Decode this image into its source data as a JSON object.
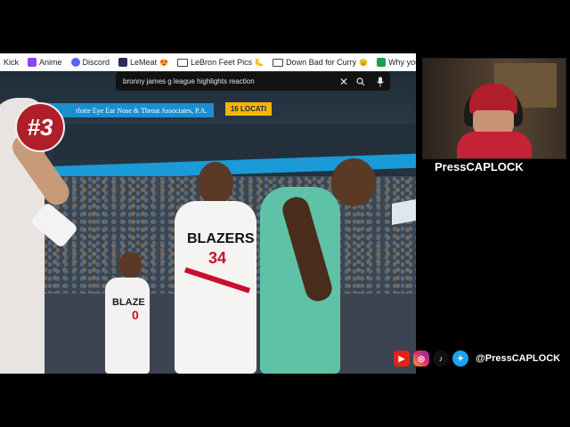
{
  "bookmarks": [
    {
      "label": "Kick",
      "icon": "kick-icon",
      "emoji": ""
    },
    {
      "label": "Anime",
      "icon": "twitch-icon",
      "emoji": ""
    },
    {
      "label": "Discord",
      "icon": "discord-icon",
      "emoji": ""
    },
    {
      "label": "LeMeat",
      "icon": "lemeat-icon",
      "emoji": "😍"
    },
    {
      "label": "LeBron Feet Pics",
      "icon": "folder-icon",
      "emoji": "🦶"
    },
    {
      "label": "Down Bad for Curry",
      "icon": "folder-icon",
      "emoji": "😉"
    },
    {
      "label": "Why you LOOKIN",
      "icon": "plus-icon",
      "emoji": ""
    }
  ],
  "search": {
    "query": "bronny james g league highlights reaction"
  },
  "overlay": {
    "rank": "#3",
    "channel_name": "PressCAPLOCK",
    "social_handle": "@PressCAPLOCK"
  },
  "arena": {
    "banner_text": "Charlotte Eye Ear Nose & Throat Associates, P.A.",
    "banner_text_visible": "rlotte Eye Ear Nose & Throat Associates, P.A.",
    "led_text": "16 LOCATI",
    "jersey_team": "BLAZERS",
    "jersey_number": "34",
    "jersey_number_small": "0",
    "jersey_team_small": "BLAZE"
  },
  "colors": {
    "blazers_red": "#c8102e",
    "hornets_teal": "#5fc2a6",
    "hornets_blue": "#1a9ad6",
    "badge_red": "#b01e2a"
  }
}
